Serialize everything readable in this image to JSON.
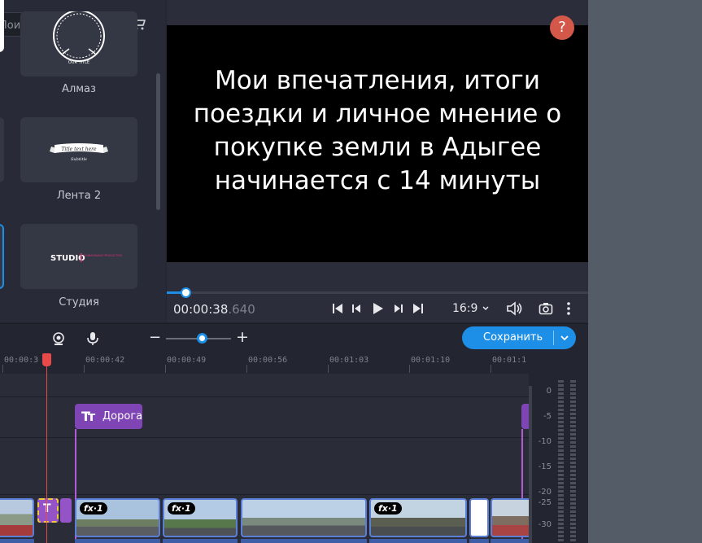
{
  "search": {
    "placeholder": "Поиск",
    "clear": "×"
  },
  "titles": [
    {
      "label": "Алмаз",
      "preview_text": "OUR TITLE"
    },
    {
      "label": "Лента 2",
      "preview_text": "Title text here",
      "preview_sub": "Subtitle"
    },
    {
      "label": "Студия",
      "preview_text": "STUDIO",
      "preview_sub": "UNIMAGINABLE PRODUCTION"
    }
  ],
  "preview": {
    "text": "Мои впечатления, итоги поездки и личное мнение о покупке земли в Адыгее начинается с 14 минуты",
    "help": "?",
    "progress": 0.045
  },
  "player": {
    "timecode_main": "00:00:38",
    "timecode_ms": ".640",
    "aspect": "16:9"
  },
  "toolbar": {
    "save_label": "Сохранить",
    "zoom_minus": "−",
    "zoom_plus": "+",
    "zoom_level": 0.55
  },
  "timeline": {
    "ruler": [
      "00:00:3",
      "00:00:42",
      "00:00:49",
      "00:00:56",
      "00:01:03",
      "00:01:10",
      "00:01:1"
    ],
    "title_clip": "Дорога",
    "fx_label": "fx·1"
  },
  "meter": {
    "labels": [
      "0",
      "-5",
      "-10",
      "-15",
      "-20",
      "-25",
      "-30"
    ]
  },
  "colors": {
    "accent": "#1e8fe6",
    "title_clip": "#7f45b5",
    "playhead": "#e84a4a",
    "help": "#d4584a"
  }
}
